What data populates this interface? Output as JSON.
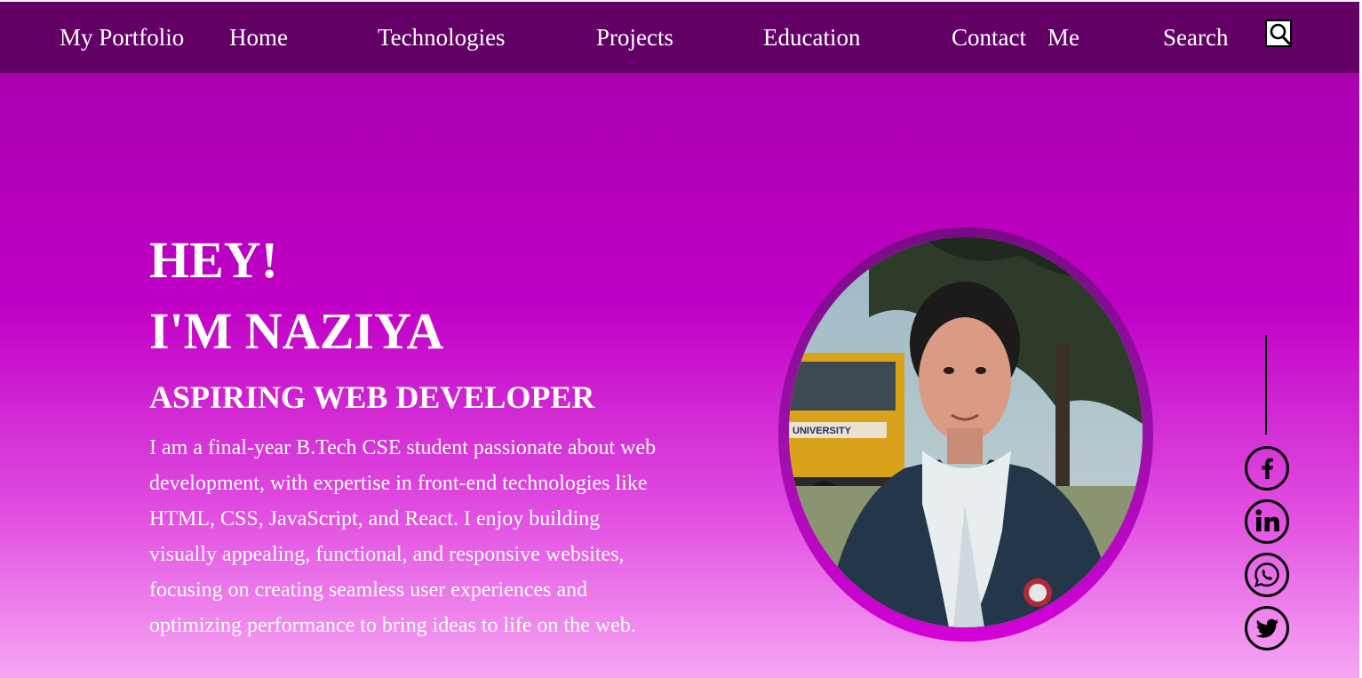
{
  "nav": {
    "brand": "My Portfolio",
    "items": [
      "Home",
      "Technologies",
      "Projects",
      "Education",
      "Contact",
      "Me",
      "Search"
    ],
    "search_icon": "search-icon"
  },
  "hero": {
    "greeting": "HEY!",
    "name": "I'M NAZIYA",
    "role": "ASPIRING WEB DEVELOPER",
    "bio": "I am a final-year B.Tech CSE student passionate about web development, with expertise in front-end technologies like HTML, CSS, JavaScript, and React. I enjoy building visually appealing, functional, and responsive websites, focusing on creating seamless user experiences and optimizing performance to bring ideas to life on the web.",
    "photo_sign": "UNIVERSITY"
  },
  "social": {
    "icons": [
      "facebook-icon",
      "linkedin-icon",
      "whatsapp-icon",
      "twitter-icon"
    ]
  },
  "colors": {
    "nav_bg": "#630066",
    "page_gradient_top": "#a200a8",
    "page_gradient_mid": "#c000c6",
    "page_gradient_bottom": "#f7a6f4",
    "text": "#ffffff"
  }
}
